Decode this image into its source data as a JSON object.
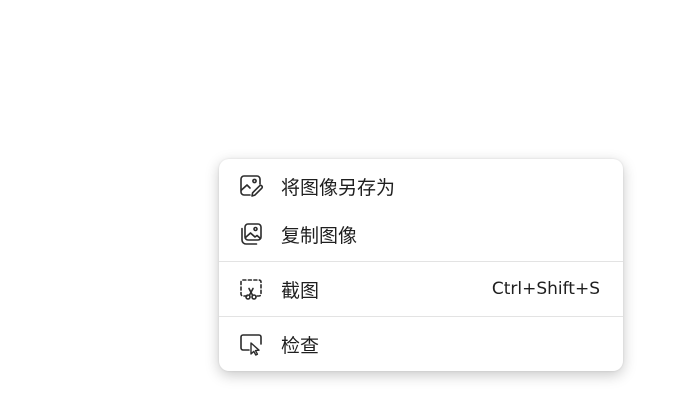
{
  "context_menu": {
    "items": [
      {
        "label": "将图像另存为",
        "icon": "image-save-icon"
      },
      {
        "label": "复制图像",
        "icon": "image-copy-icon"
      },
      {
        "label": "截图",
        "icon": "screenshot-icon",
        "shortcut": "Ctrl+Shift+S"
      },
      {
        "label": "检查",
        "icon": "inspect-icon"
      }
    ]
  },
  "colors": {
    "text": "#1f1f1f",
    "separator": "#e3e3e3",
    "menu_background": "#ffffff"
  }
}
